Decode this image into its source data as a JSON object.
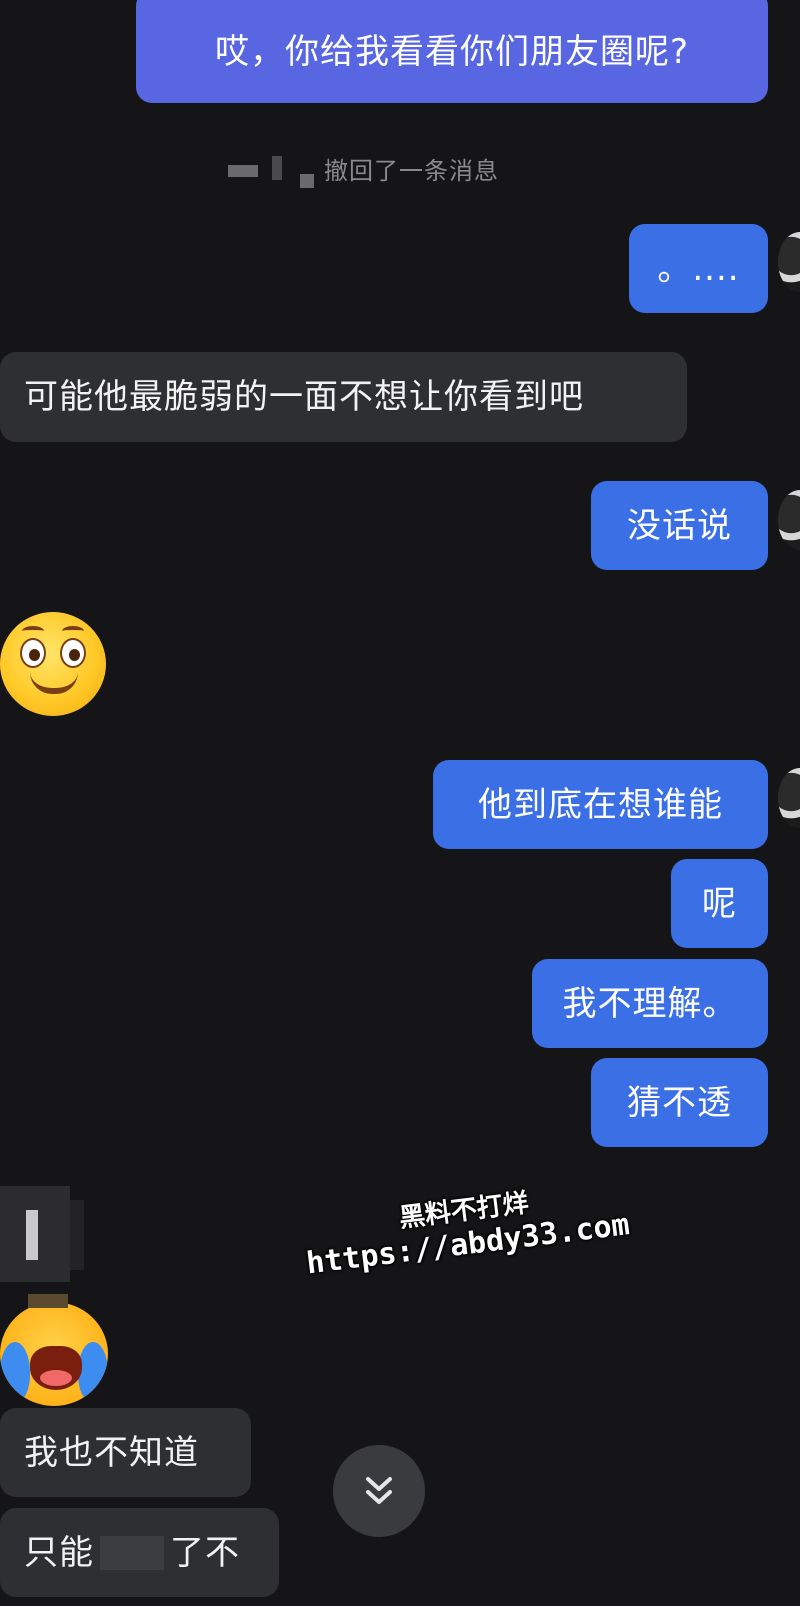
{
  "messages": {
    "m1": "哎，你给我看看你们朋友圈呢?",
    "recall": "撤回了一条消息",
    "m2": "。....",
    "m3": "可能他最脆弱的一面不想让你看到吧",
    "m4": "没话说",
    "m5": "他到底在想谁能",
    "m6": "呢",
    "m7": "我不理解。",
    "m8": "猜不透",
    "m9": "我也不知道",
    "m10_a": "只能",
    "m10_b": "了不"
  },
  "emoji": {
    "first": "smile-emoji",
    "second": "crying-laughing-emoji"
  },
  "watermark": {
    "line1": "黑料不打烊",
    "line2": "https://abdy33.com"
  },
  "scroll_button": {
    "icon": "double-chevron-down-icon",
    "glyph": "⌄⌄"
  },
  "colors": {
    "background": "#151517",
    "outgoing": "#3b6fe6",
    "incoming": "#2e2f33"
  }
}
